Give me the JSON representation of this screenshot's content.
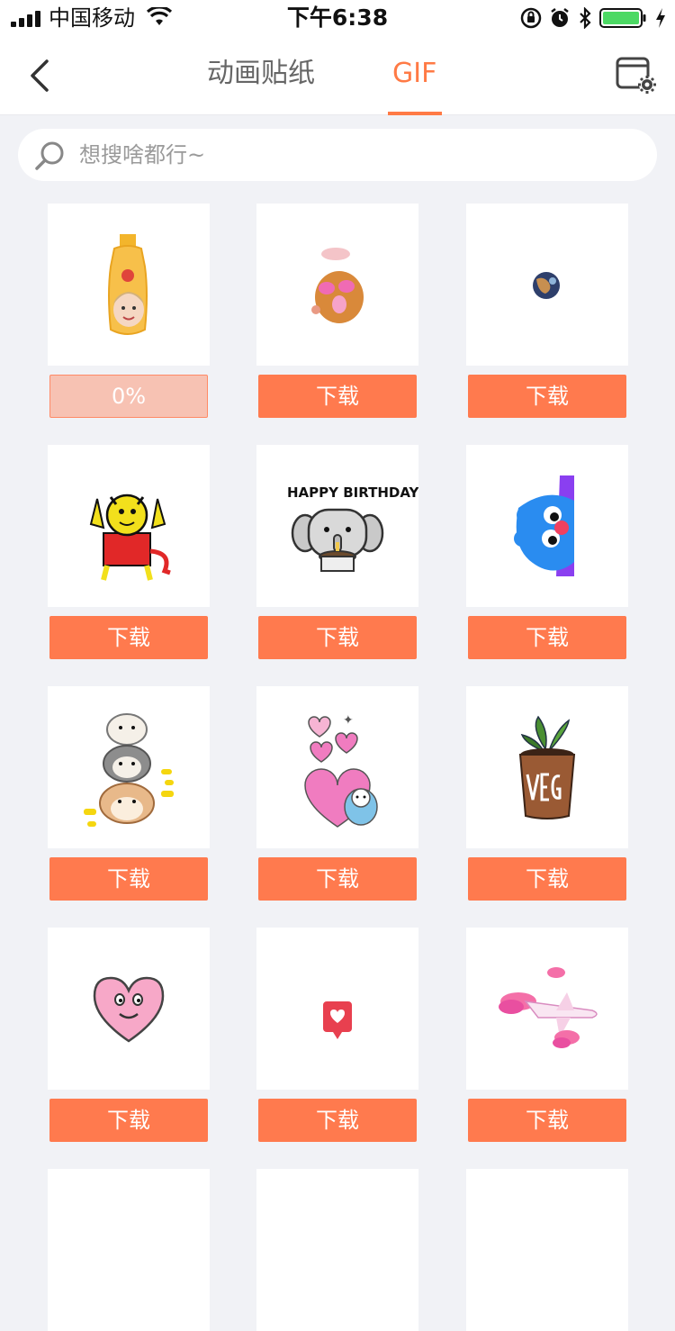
{
  "status": {
    "carrier": "中国移动",
    "time": "下午6:38"
  },
  "nav": {
    "tabs": [
      {
        "label": "动画贴纸"
      },
      {
        "label": "GIF"
      }
    ],
    "active_tab": "GIF"
  },
  "search": {
    "placeholder": "想搜啥都行~"
  },
  "colors": {
    "accent": "#ff7a45",
    "button": "#ff7a4e",
    "progress_bg": "#f7c2b3",
    "page_bg": "#f1f2f6"
  },
  "stickers": [
    {
      "icon": "baby-shampoo-face-icon",
      "action": "0%",
      "progress": 0
    },
    {
      "icon": "pink-potato-icon",
      "action": "下载"
    },
    {
      "icon": "small-planet-icon",
      "action": "下载"
    },
    {
      "icon": "red-devil-icon",
      "action": "下载"
    },
    {
      "icon": "happy-birthday-elephant-icon",
      "action": "下载"
    },
    {
      "icon": "blue-monster-icon",
      "action": "下载"
    },
    {
      "icon": "stacked-dogs-icon",
      "action": "下载"
    },
    {
      "icon": "pink-hearts-icon",
      "action": "下载"
    },
    {
      "icon": "vegan-plant-pot-icon",
      "action": "下载"
    },
    {
      "icon": "smiling-heart-icon",
      "action": "下载"
    },
    {
      "icon": "heart-pin-icon",
      "action": "下载"
    },
    {
      "icon": "airplane-clouds-icon",
      "action": "下载"
    }
  ],
  "extra_row_visible": true
}
